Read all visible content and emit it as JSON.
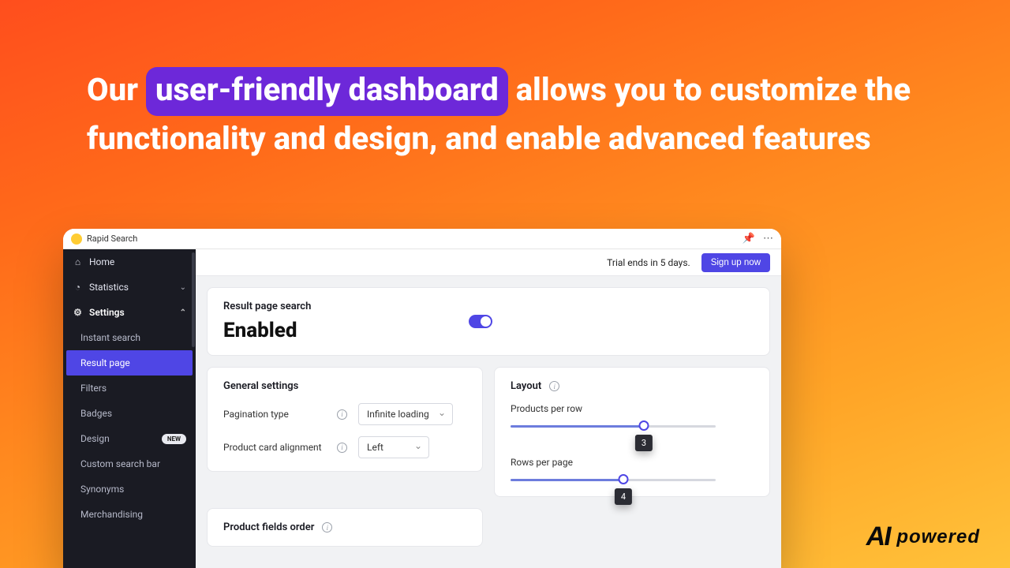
{
  "headline": {
    "pre": "Our ",
    "highlight": "user-friendly dashboard",
    "post": " allows you to customize the functionality and design, and enable advanced features"
  },
  "app": {
    "title": "Rapid Search",
    "trial_text": "Trial ends in 5 days.",
    "signup_label": "Sign up now"
  },
  "sidebar": {
    "home": "Home",
    "statistics": "Statistics",
    "settings": "Settings",
    "items": [
      "Instant search",
      "Result page",
      "Filters",
      "Badges",
      "Design",
      "Custom search bar",
      "Synonyms",
      "Merchandising"
    ],
    "new_badge": "NEW"
  },
  "result_page": {
    "section_label": "Result page search",
    "status": "Enabled"
  },
  "general": {
    "title": "General settings",
    "pagination_label": "Pagination type",
    "pagination_value": "Infinite loading",
    "alignment_label": "Product card alignment",
    "alignment_value": "Left"
  },
  "layout": {
    "title": "Layout",
    "ppr_label": "Products per row",
    "ppr_value": "3",
    "ppr_percent": 65,
    "rpp_label": "Rows per page",
    "rpp_value": "4",
    "rpp_percent": 55
  },
  "fields_order": {
    "title": "Product fields order"
  },
  "footer": {
    "mark": "AI",
    "text": "powered"
  }
}
